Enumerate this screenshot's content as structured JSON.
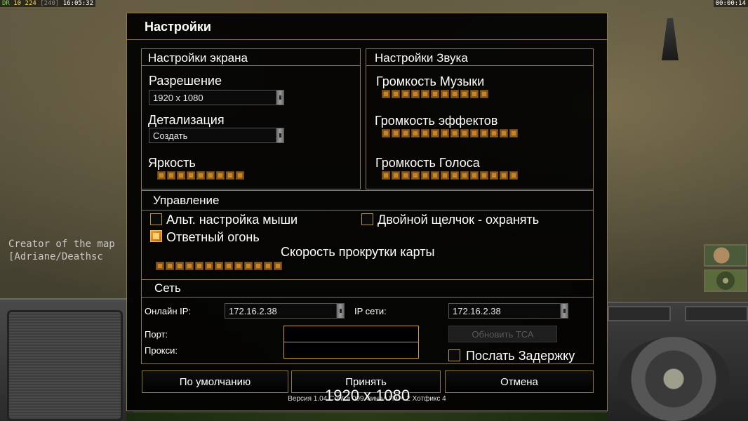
{
  "hud": {
    "left": {
      "a": "DR",
      "b": "10",
      "c": "224",
      "d": "[240]",
      "e": "16:05:32"
    },
    "right": "00:00:14"
  },
  "background": {
    "creator_line1": "Creator of the map",
    "creator_line2": "[Adriane/Deathsc"
  },
  "dialog": {
    "title": "Настройки",
    "screen": {
      "title": "Настройки экрана",
      "resolution_label": "Разрешение",
      "resolution_value": "1920 x 1080",
      "detail_label": "Детализация",
      "detail_value": "Создать",
      "brightness_label": "Яркость",
      "brightness_segments": 9
    },
    "sound": {
      "title": "Настройки Звука",
      "music_label": "Громкость Музыки",
      "music_segments": 11,
      "effects_label": "Громкость эффектов",
      "effects_segments": 14,
      "voice_label": "Громкость Голоса",
      "voice_segments": 14
    },
    "controls": {
      "title": "Управление",
      "alt_mouse_label": "Альт. настройка мыши",
      "alt_mouse_checked": false,
      "double_click_label": "Двойной щелчок - охранять",
      "double_click_checked": false,
      "return_fire_label": "Ответный огонь",
      "return_fire_checked": true,
      "scroll_speed_label": "Скорость прокрутки карты",
      "scroll_speed_segments": 13
    },
    "network": {
      "title": "Сеть",
      "online_ip_label": "Онлайн IP:",
      "online_ip_value": "172.16.2.38",
      "lan_ip_label": "IP сети:",
      "lan_ip_value": "172.16.2.38",
      "port_label": "Порт:",
      "port_value": "",
      "proxy_label": "Прокси:",
      "proxy_value": "",
      "update_button": "Обновить ТСА",
      "send_delay_label": "Послать Задержку",
      "send_delay_checked": false
    },
    "buttons": {
      "defaults": "По умолчанию",
      "accept": "Принять",
      "cancel": "Отмена"
    },
    "version": "Версия 1.04 Contra 009 Финал Патч 2 Хотфикс 4",
    "overlay_text": "1920 x 1080"
  },
  "colors": {
    "accent_border": "#8a7a3e",
    "slider_segment": "#c7852c",
    "field_border": "#c8a040"
  }
}
